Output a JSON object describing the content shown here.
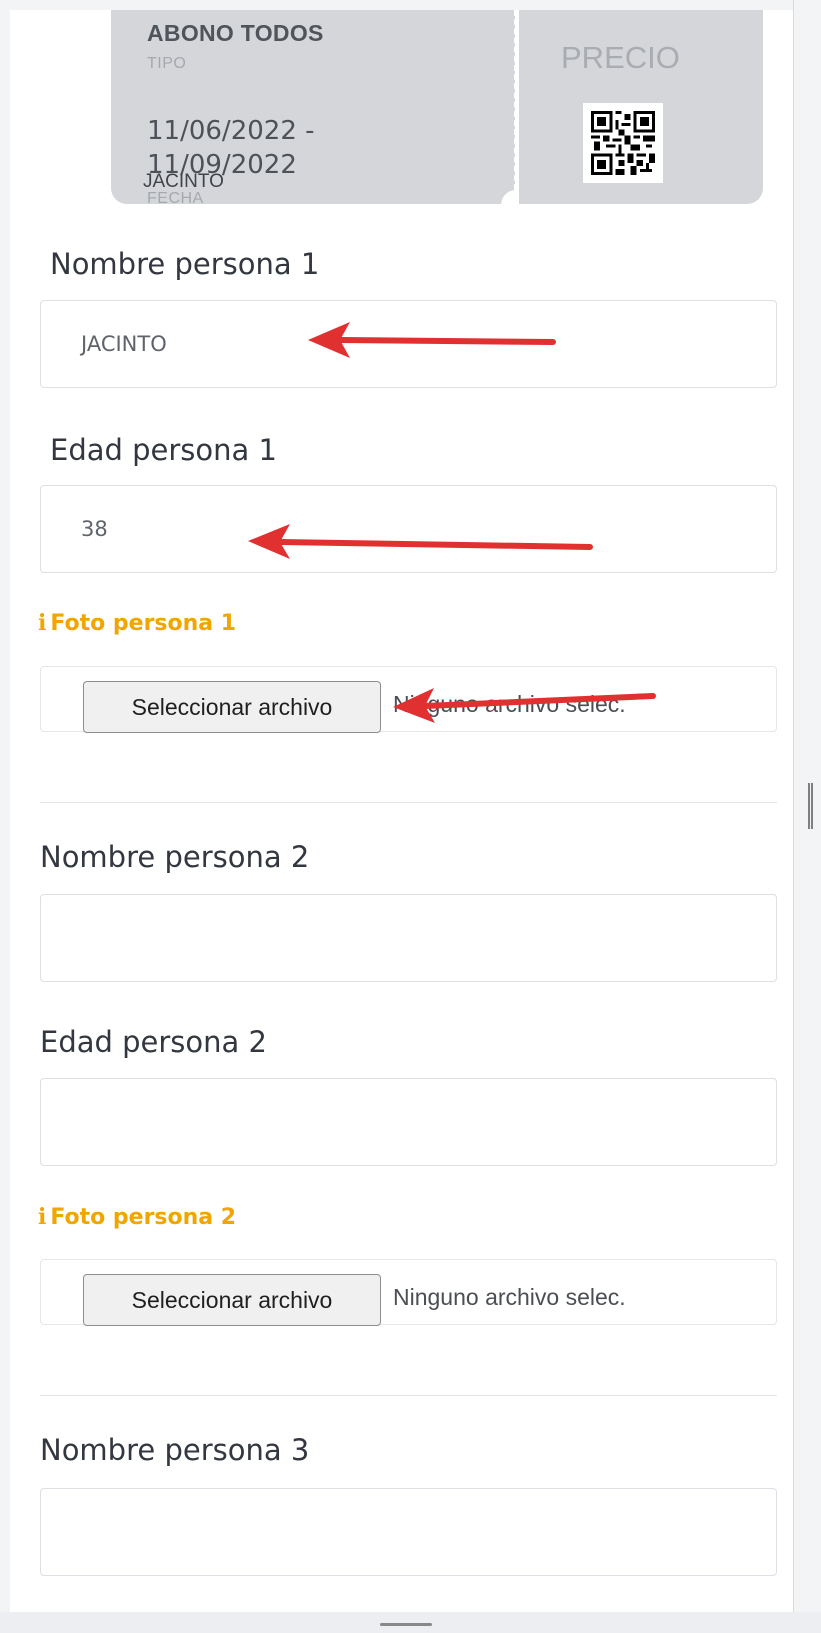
{
  "ticket": {
    "type_value": "ABONO TODOS",
    "type_label": "TIPO",
    "date_value": "11/06/2022 - 11/09/2022",
    "name_value": "JACINTO",
    "date_label": "FECHA",
    "price_label": "PRECIO",
    "qr_icon": "qr-code-icon"
  },
  "form": {
    "persons": [
      {
        "name_label": "Nombre persona 1",
        "name_value": "JACINTO",
        "age_label": "Edad persona 1",
        "age_value": "38",
        "photo_label": "Foto persona 1",
        "file_button": "Seleccionar archivo",
        "file_status": "Ninguno archivo selec."
      },
      {
        "name_label": "Nombre persona 2",
        "name_value": "",
        "age_label": "Edad persona 2",
        "age_value": "",
        "photo_label": "Foto persona 2",
        "file_button": "Seleccionar archivo",
        "file_status": "Ninguno archivo selec."
      },
      {
        "name_label": "Nombre persona 3",
        "name_value": ""
      }
    ],
    "info_icon": "i",
    "photo_label_color": "#f0a500"
  },
  "annotations": {
    "arrow_color": "#e03030"
  }
}
